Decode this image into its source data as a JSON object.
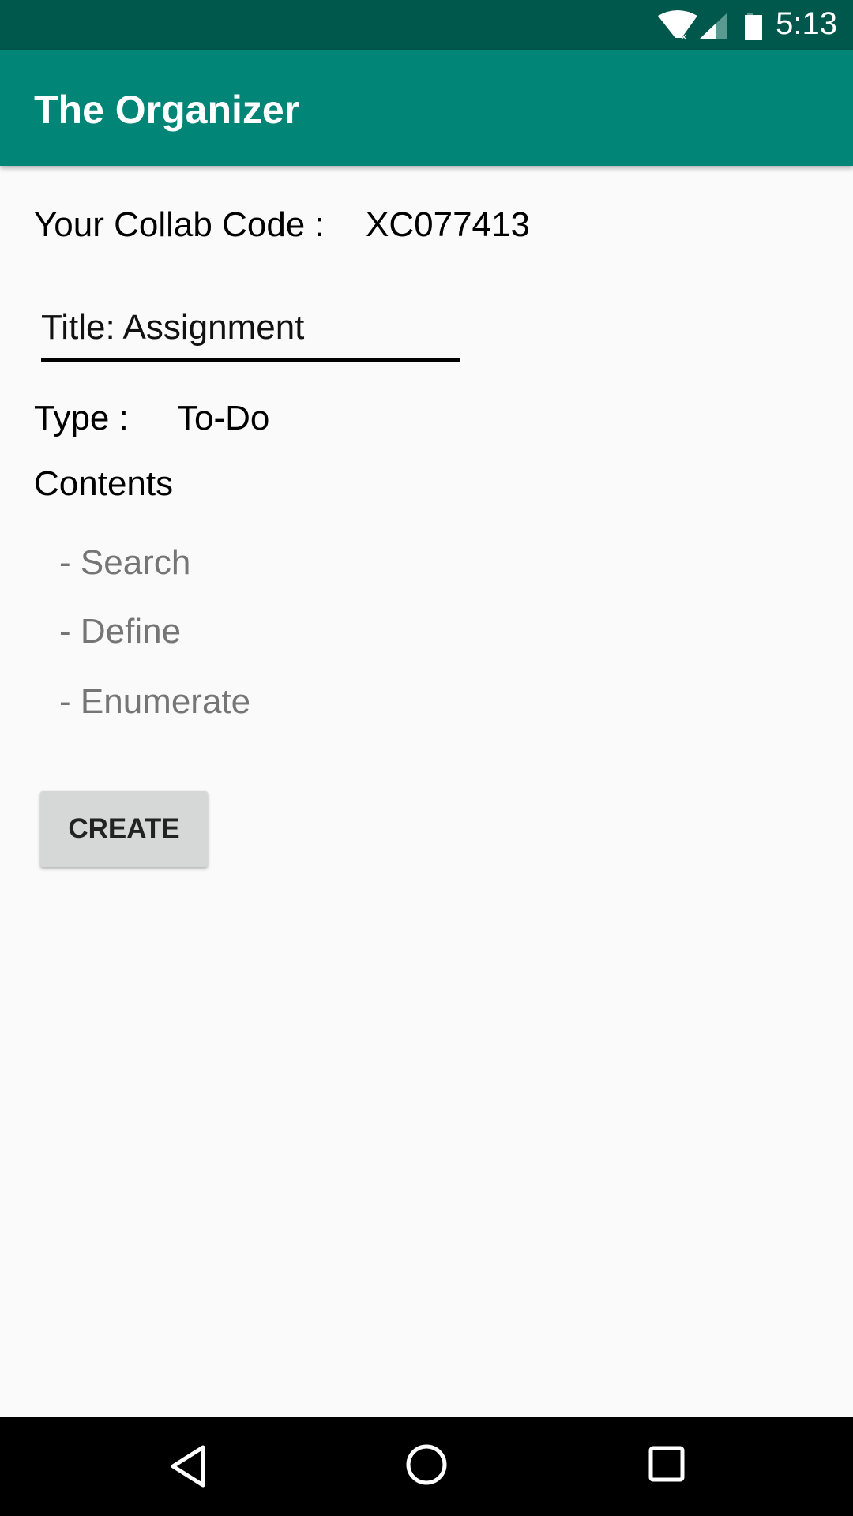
{
  "status_bar": {
    "time": "5:13",
    "icons": [
      "wifi-off-icon",
      "signal-icon",
      "battery-icon"
    ]
  },
  "app_bar": {
    "title": "The Organizer"
  },
  "collab": {
    "label": "Your Collab Code :",
    "code": "XC077413"
  },
  "title_field": {
    "value": "Title: Assignment"
  },
  "type": {
    "label": "Type :",
    "value": "To-Do"
  },
  "contents": {
    "label": "Contents",
    "items": [
      "- Search",
      "- Define",
      "- Enumerate"
    ]
  },
  "create_button": {
    "label": "CREATE"
  },
  "nav_bar": {
    "icons": [
      "back-icon",
      "home-icon",
      "recents-icon"
    ]
  }
}
